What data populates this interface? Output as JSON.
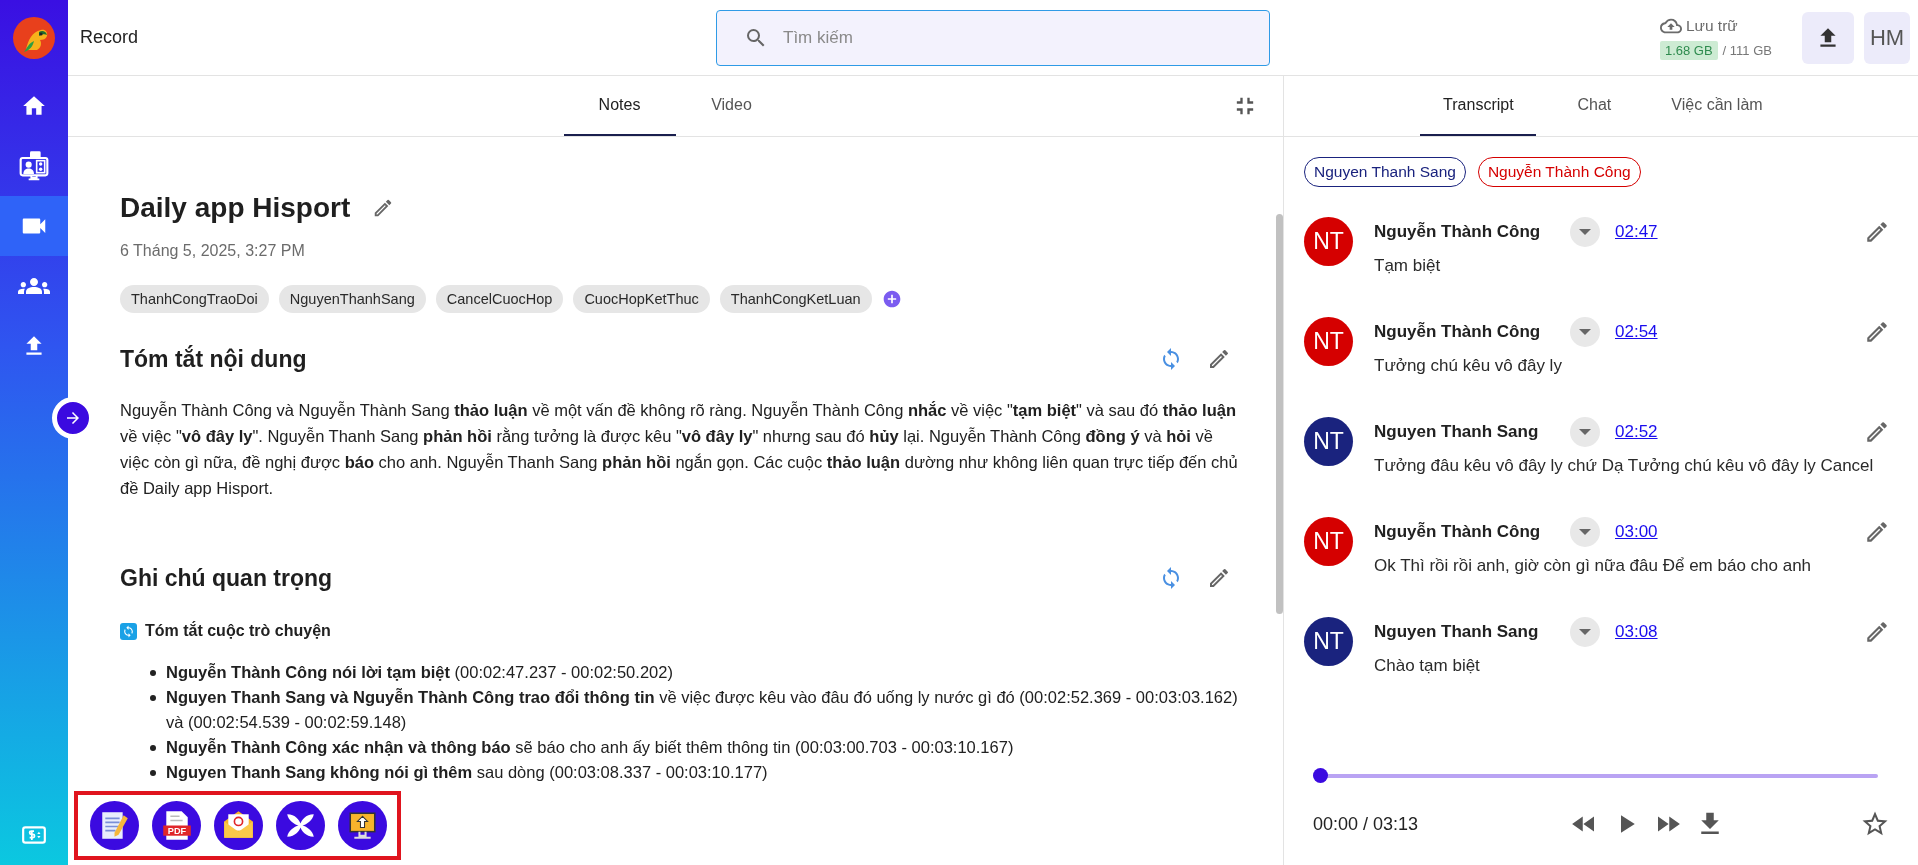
{
  "app": {
    "title": "Record"
  },
  "sidebar": {
    "items": [
      {
        "kind": "home",
        "selected": false
      },
      {
        "kind": "meetings",
        "selected": false
      },
      {
        "kind": "video",
        "selected": true
      },
      {
        "kind": "team",
        "selected": false
      },
      {
        "kind": "upload",
        "selected": false
      }
    ],
    "bottom_items": [
      {
        "kind": "billing",
        "selected": false
      }
    ]
  },
  "search": {
    "placeholder": "Tìm kiếm"
  },
  "storage": {
    "label": "Lưu trữ",
    "used": "1.68 GB",
    "total": "/ 111 GB"
  },
  "user": {
    "initials": "HM"
  },
  "notes_tabs": [
    {
      "label": "Notes",
      "selected": true
    },
    {
      "label": "Video",
      "selected": false
    }
  ],
  "note": {
    "title": "Daily app Hisport",
    "date": "6 Tháng 5, 2025, 3:27 PM",
    "tags": [
      "ThanhCongTraoDoi",
      "NguyenThanhSang",
      "CancelCuocHop",
      "CuocHopKetThuc",
      "ThanhCongKetLuan"
    ],
    "sections": [
      {
        "kind": "paragraph",
        "heading": "Tóm tắt nội dung",
        "text": "Nguyễn Thành Công và Nguyễn Thành Sang **thảo luận** về một vấn đề không rõ ràng. Nguyễn Thành Công **nhắc** về việc \"**tạm biệt**\" và sau đó **thảo luận** về việc \"**vô đây ly**\". Nguyễn Thanh Sang **phản hồi** rằng tưởng là được kêu \"**vô đây ly**\" nhưng sau đó **hủy** lại. Nguyễn Thành Công **đồng ý** và **hỏi** về việc còn gì nữa, đề nghị được **báo** cho anh. Nguyễn Thanh Sang **phản hồi** ngắn gọn. Các cuộc **thảo luận** dường như không liên quan trực tiếp đến chủ đề Daily app Hisport."
      },
      {
        "kind": "list",
        "heading": "Ghi chú quan trọng",
        "subheading": "Tóm tắt cuộc trò chuyện",
        "items": [
          "**Nguyễn Thành Công nói lời tạm biệt** (00:02:47.237 - 00:02:50.202)",
          "**Nguyen Thanh Sang và Nguyễn Thành Công trao đổi thông tin** về việc được kêu vào đâu đó uống ly nước gì đó (00:02:52.369 - 00:03:03.162) và (00:02:54.539 - 00:02:59.148)",
          "**Nguyễn Thành Công xác nhận và thông báo** sẽ báo cho anh ấy biết thêm thông tin (00:03:00.703 - 00:03:10.167)",
          "**Nguyen Thanh Sang không nói gì thêm** sau dòng (00:03:08.337 - 00:03:10.177)"
        ]
      }
    ]
  },
  "export_toolbar": {
    "highlighted": true,
    "actions": [
      {
        "kind": "document"
      },
      {
        "kind": "pdf",
        "label": "PDF"
      },
      {
        "kind": "mail"
      },
      {
        "kind": "cross"
      },
      {
        "kind": "screen-upload"
      }
    ]
  },
  "side_tabs": [
    {
      "label": "Transcript",
      "selected": true
    },
    {
      "label": "Chat",
      "selected": false
    },
    {
      "label": "Việc cần làm",
      "selected": false
    }
  ],
  "speakers": [
    {
      "name": "Nguyen Thanh Sang",
      "color": "#1a237e"
    },
    {
      "name": "Nguyễn Thành Công",
      "color": "#d50000"
    }
  ],
  "transcript": [
    {
      "initials": "NT",
      "speaker": "Nguyễn Thành Công",
      "color": "#d50000",
      "time": "02:47",
      "text": "Tạm biệt"
    },
    {
      "initials": "NT",
      "speaker": "Nguyễn Thành Công",
      "color": "#d50000",
      "time": "02:54",
      "text": "Tưởng chú kêu vô đây ly"
    },
    {
      "initials": "NT",
      "speaker": "Nguyen Thanh Sang",
      "color": "#1a237e",
      "time": "02:52",
      "text": "Tưởng đâu kêu vô đây ly chứ Dạ Tưởng chú kêu vô đây ly Cancel"
    },
    {
      "initials": "NT",
      "speaker": "Nguyễn Thành Công",
      "color": "#d50000",
      "time": "03:00",
      "text": "Ok Thì rồi rồi anh, giờ còn gì nữa đâu Để em báo cho anh"
    },
    {
      "initials": "NT",
      "speaker": "Nguyen Thanh Sang",
      "color": "#1a237e",
      "time": "03:08",
      "text": "Chào tạm biệt"
    }
  ],
  "player": {
    "level": 0,
    "time": "00:00 / 03:13"
  }
}
